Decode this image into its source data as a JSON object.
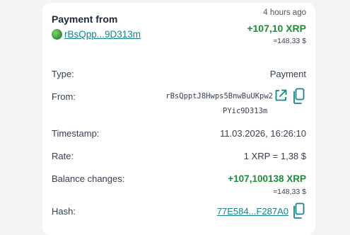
{
  "header": {
    "title": "Payment from",
    "address_short": "rBsQpp...9D313m",
    "time_ago": "4 hours ago",
    "amount": "+107,10 XRP",
    "amount_fiat": "≈148,33 $"
  },
  "details": {
    "type_label": "Type:",
    "type_value": "Payment",
    "from_label": "From:",
    "from_line1": "rBsQpptJ8Hwps5BnwBuUKpw2",
    "from_line2": "PYic9D313m",
    "timestamp_label": "Timestamp:",
    "timestamp_value": "11.03.2026, 16:26:10",
    "rate_label": "Rate:",
    "rate_value": "1 XRP = 1,38 $",
    "balance_label": "Balance changes:",
    "balance_value": "+107,100138 XRP",
    "balance_fiat": "≈148,33 $",
    "hash_label": "Hash:",
    "hash_value": "77E584...F287A0"
  },
  "colors": {
    "positive": "#1f8a3b",
    "link": "#13858f"
  },
  "icons": {
    "address_avatar": "globe-avatar-icon",
    "external_link": "external-link-icon",
    "copy": "copy-icon"
  }
}
